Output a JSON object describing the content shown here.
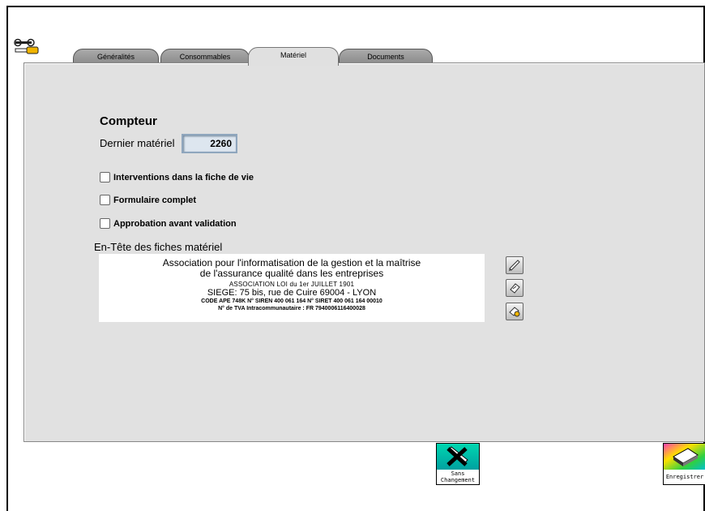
{
  "tabs": [
    {
      "label": "Généralités"
    },
    {
      "label": "Consommables"
    },
    {
      "label": "Matériel"
    },
    {
      "label": "Documents"
    }
  ],
  "active_tab": "Matériel",
  "counter": {
    "title": "Compteur",
    "label": "Dernier matériel",
    "value": "2260"
  },
  "options": [
    {
      "label": "Interventions dans la fiche de vie",
      "checked": false
    },
    {
      "label": "Formulaire complet",
      "checked": false
    },
    {
      "label": "Approbation avant validation",
      "checked": false
    }
  ],
  "header": {
    "label": "En-Tête des fiches matériel",
    "line1": "Association pour l'informatisation de la gestion et la maîtrise",
    "line2": "de l'assurance qualité dans les entreprises",
    "line3": "ASSOCIATION LOI du 1er JUILLET 1901",
    "line4": "SIEGE:   75 bis, rue de Cuire 69004 - LYON",
    "line5": "CODE APE 748K  N° SIREN 400 061 164  N° SIRET 400 061 164 00010",
    "line6": "N° de TVA Intracommunautaire : FR 7940006116400028"
  },
  "buttons": {
    "no_change_label_1": "Sans",
    "no_change_label_2": "Changement",
    "save_label": "Enregistrer"
  }
}
